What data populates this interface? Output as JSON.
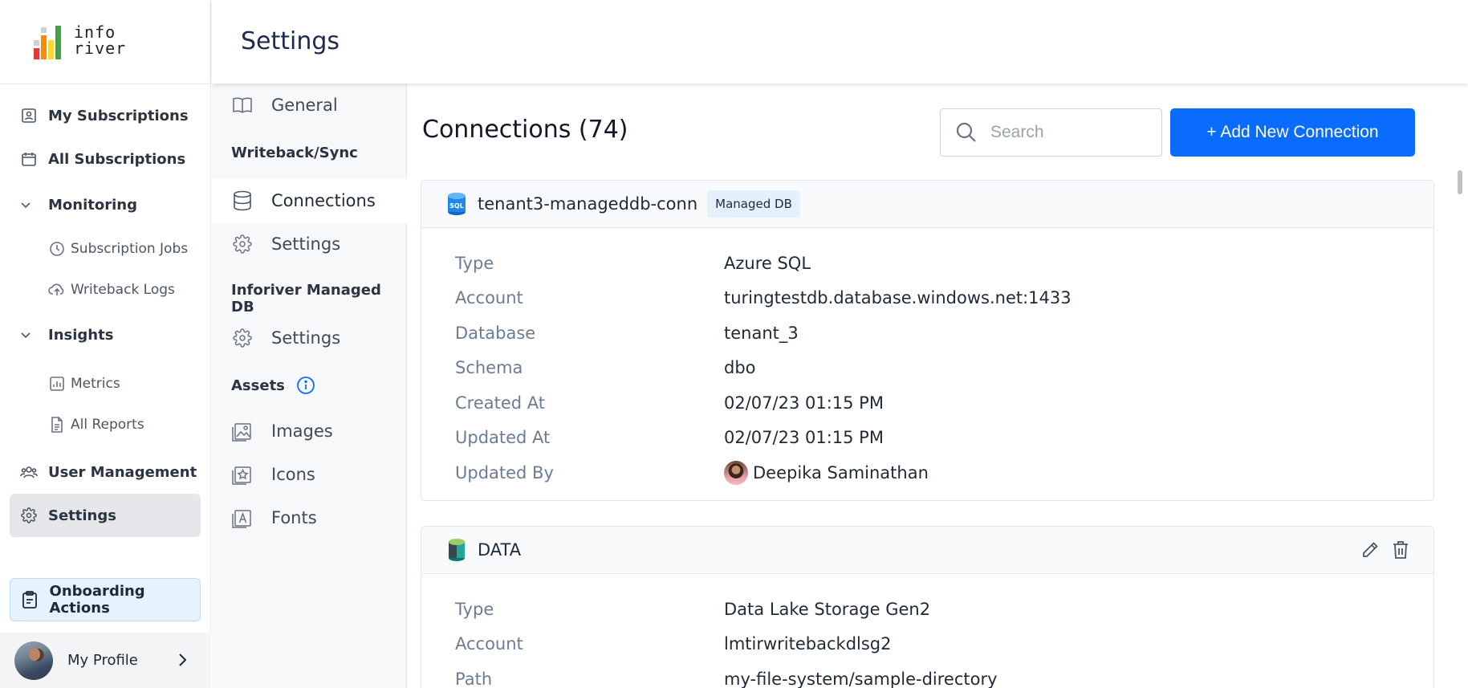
{
  "app": {
    "logo_text_line1": "info",
    "logo_text_line2": "river",
    "page_title": "Settings"
  },
  "sidebar": {
    "items": [
      {
        "label": "My Subscriptions",
        "icon": "user-badge-icon"
      },
      {
        "label": "All Subscriptions",
        "icon": "calendar-icon"
      },
      {
        "label": "Monitoring",
        "icon": "chevron-down-icon",
        "expanded": true
      },
      {
        "label": "Subscription Jobs",
        "icon": "clock-icon"
      },
      {
        "label": "Writeback Logs",
        "icon": "cloud-upload-icon"
      },
      {
        "label": "Insights",
        "icon": "chevron-down-icon",
        "expanded": true
      },
      {
        "label": "Metrics",
        "icon": "bar-chart-icon"
      },
      {
        "label": "All Reports",
        "icon": "document-icon"
      },
      {
        "label": "User Management",
        "icon": "users-icon"
      },
      {
        "label": "Settings",
        "icon": "gear-icon",
        "active": true
      }
    ],
    "onboarding_label": "Onboarding Actions",
    "profile_label": "My Profile"
  },
  "subnav": {
    "general": "General",
    "writeback_heading": "Writeback/Sync",
    "connections": "Connections",
    "writeback_settings": "Settings",
    "managed_db_heading": "Inforiver Managed DB",
    "managed_db_settings": "Settings",
    "assets_heading": "Assets",
    "images": "Images",
    "icons": "Icons",
    "fonts": "Fonts"
  },
  "main": {
    "title": "Connections (74)",
    "search_placeholder": "Search",
    "add_button": "+ Add New Connection",
    "cards": [
      {
        "name": "tenant3-manageddb-conn",
        "badge": "Managed DB",
        "icon": "sql-database-icon",
        "rows": [
          {
            "key": "Type",
            "value": "Azure SQL"
          },
          {
            "key": "Account",
            "value": "turingtestdb.database.windows.net:1433"
          },
          {
            "key": "Database",
            "value": "tenant_3"
          },
          {
            "key": "Schema",
            "value": "dbo"
          },
          {
            "key": "Created At",
            "value": "02/07/23 01:15 PM"
          },
          {
            "key": "Updated At",
            "value": "02/07/23 01:15 PM"
          },
          {
            "key": "Updated By",
            "value": "Deepika Saminathan"
          }
        ]
      },
      {
        "name": "DATA",
        "icon": "data-lake-icon",
        "rows": [
          {
            "key": "Type",
            "value": "Data Lake Storage Gen2"
          },
          {
            "key": "Account",
            "value": "lmtirwritebackdlsg2"
          },
          {
            "key": "Path",
            "value": "my-file-system/sample-directory"
          }
        ]
      }
    ]
  },
  "colors": {
    "accent": "#0a6cff",
    "logo_red": "#e53935",
    "logo_orange": "#fb8c00",
    "logo_yellow": "#fdd835",
    "logo_green": "#43a047"
  }
}
